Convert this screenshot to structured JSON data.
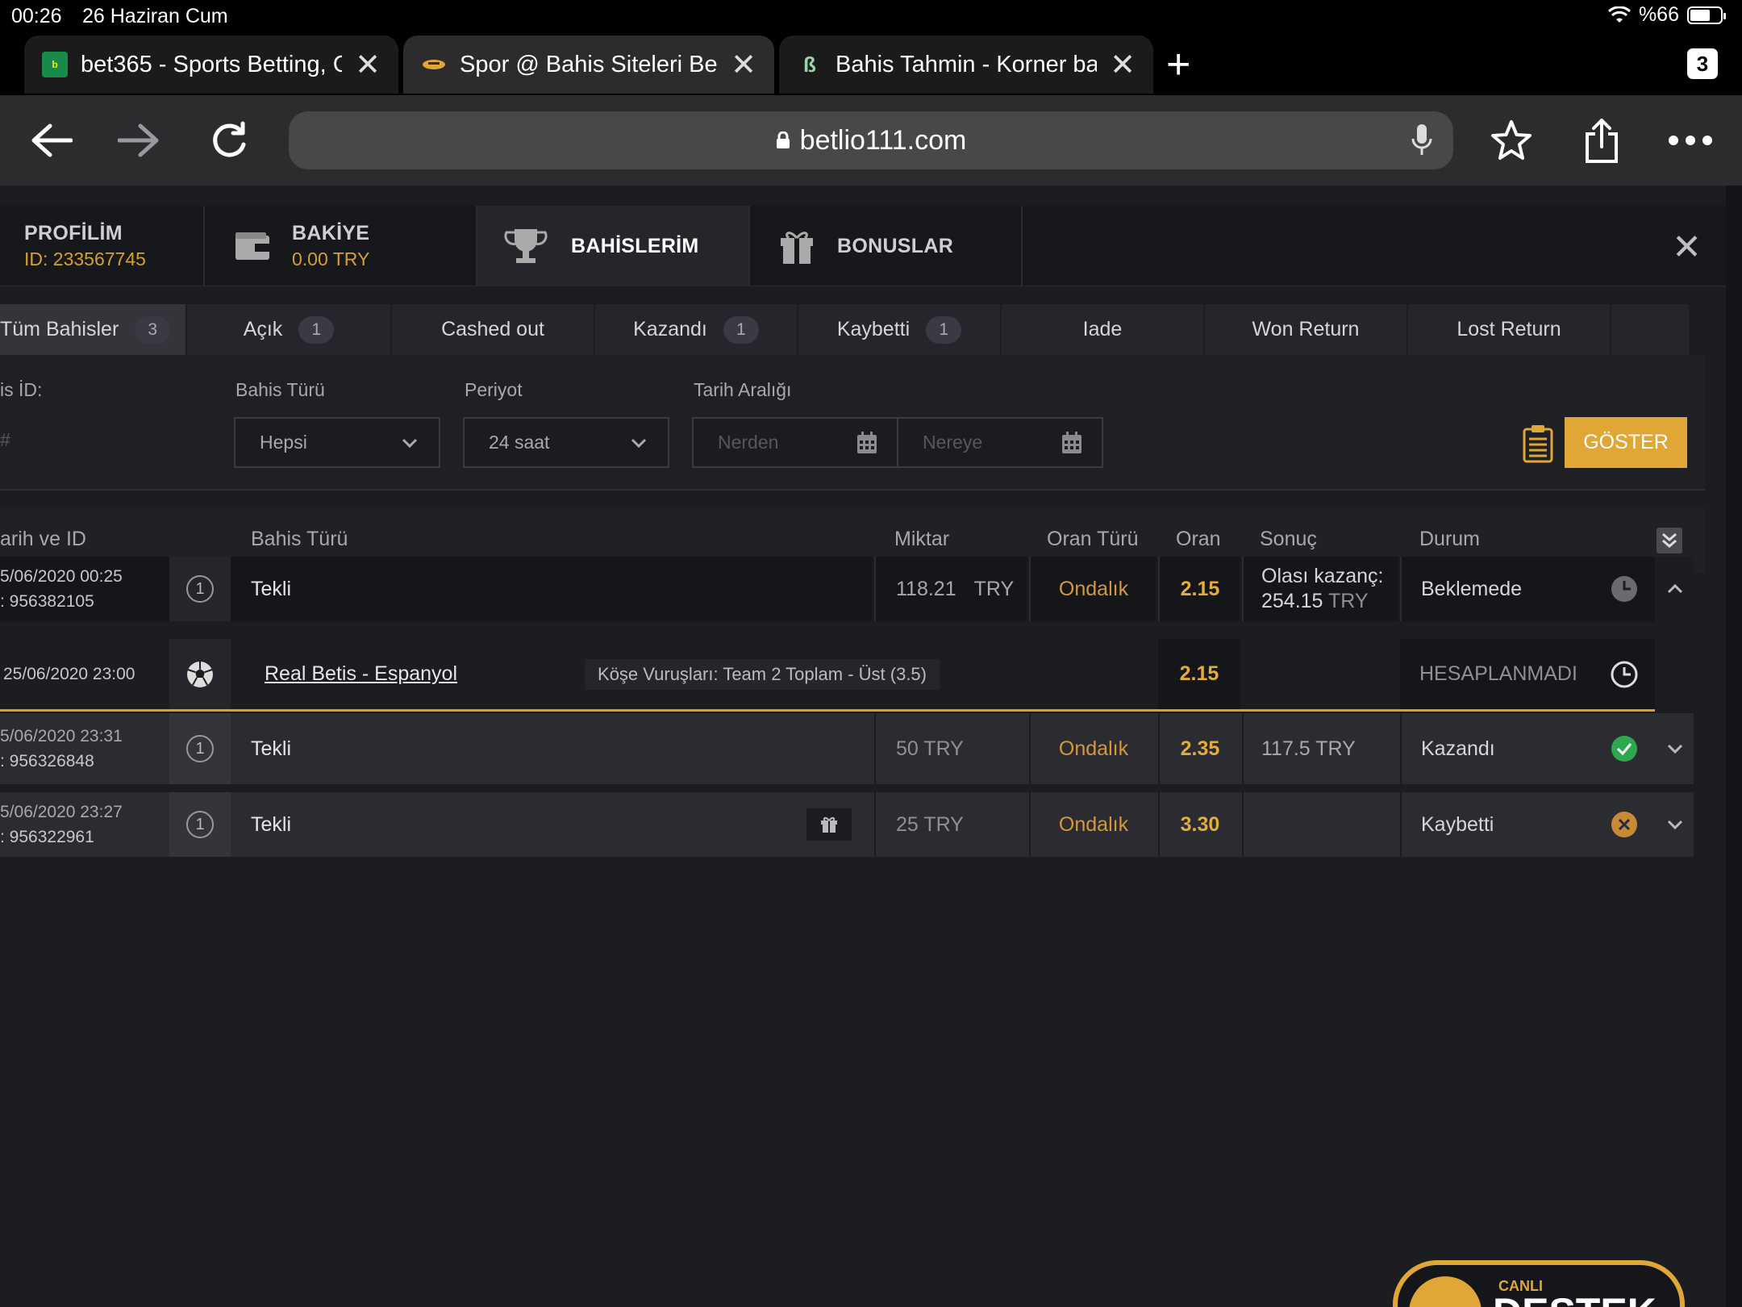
{
  "status": {
    "time": "00:26",
    "date": "26 Haziran Cum",
    "battery": "%66",
    "battery_level": 0.66
  },
  "tabs": [
    {
      "title": "bet365 - Sports Betting, C",
      "favicon": "bet365-icon"
    },
    {
      "title": "Spor @ Bahis Siteleri Betlio",
      "favicon": "betlio-icon"
    },
    {
      "title": "Bahis Tahmin - Korner bah",
      "favicon": "bahis-tahmin-icon"
    }
  ],
  "tab_count": "3",
  "address": {
    "url": "betlio111.com"
  },
  "topnav": {
    "profile_label": "PROFİLİM",
    "profile_id": "ID: 233567745",
    "balance_label": "BAKİYE",
    "balance_value": "0.00 TRY",
    "bets_label": "BAHİSLERİM",
    "bonus_label": "BONUSLAR"
  },
  "filters": [
    {
      "label": "Tüm Bahisler",
      "count": "3"
    },
    {
      "label": "Açık",
      "count": "1"
    },
    {
      "label": "Cashed out",
      "count": ""
    },
    {
      "label": "Kazandı",
      "count": "1"
    },
    {
      "label": "Kaybetti",
      "count": "1"
    },
    {
      "label": "Iade",
      "count": ""
    },
    {
      "label": "Won Return",
      "count": ""
    },
    {
      "label": "Lost Return",
      "count": ""
    }
  ],
  "form": {
    "bet_id_label": "is İD:",
    "bet_id_value": "#",
    "bet_type_label": "Bahis Türü",
    "bet_type_value": "Hepsi",
    "period_label": "Periyot",
    "period_value": "24 saat",
    "date_range_label": "Tarih Aralığı",
    "from_placeholder": "Nerden",
    "to_placeholder": "Nereye",
    "show_button": "GÖSTER"
  },
  "table": {
    "headers": {
      "date_id": "arih ve ID",
      "bet_type": "Bahis Türü",
      "amount": "Miktar",
      "odds_type": "Oran Türü",
      "odds": "Oran",
      "result": "Sonuç",
      "status": "Durum"
    },
    "rows": [
      {
        "date": "5/06/2020 00:25",
        "id": ": 956382105",
        "type_num": "1",
        "type": "Tekli",
        "amount": "118.21",
        "currency": "TRY",
        "odds_type": "Ondalık",
        "odds": "2.15",
        "result_line1": "Olası kazanç:",
        "result_line2": "254.15",
        "result_cur": "TRY",
        "status": "Beklemede"
      },
      {
        "date": "25/06/2020 23:00",
        "event": "Real Betis - Espanyol",
        "market": "Köşe Vuruşları: Team 2 Toplam - Üst (3.5)",
        "odds": "2.15",
        "status": "HESAPLANMADI"
      },
      {
        "date": "5/06/2020 23:31",
        "id": ": 956326848",
        "type_num": "1",
        "type": "Tekli",
        "amount": "50 TRY",
        "odds_type": "Ondalık",
        "odds": "2.35",
        "result": "117.5 TRY",
        "status": "Kazandı"
      },
      {
        "date": "5/06/2020 23:27",
        "id": ": 956322961",
        "type_num": "1",
        "type": "Tekli",
        "amount": "25 TRY",
        "odds_type": "Ondalık",
        "odds": "3.30",
        "result": "",
        "status": "Kaybetti"
      }
    ]
  },
  "support": {
    "line1": "CANLI",
    "line2": "DESTEK"
  },
  "colors": {
    "accent": "#e0a737",
    "odds": "#e4ac3b",
    "won": "#2ea84f",
    "lost": "#c98a36"
  }
}
